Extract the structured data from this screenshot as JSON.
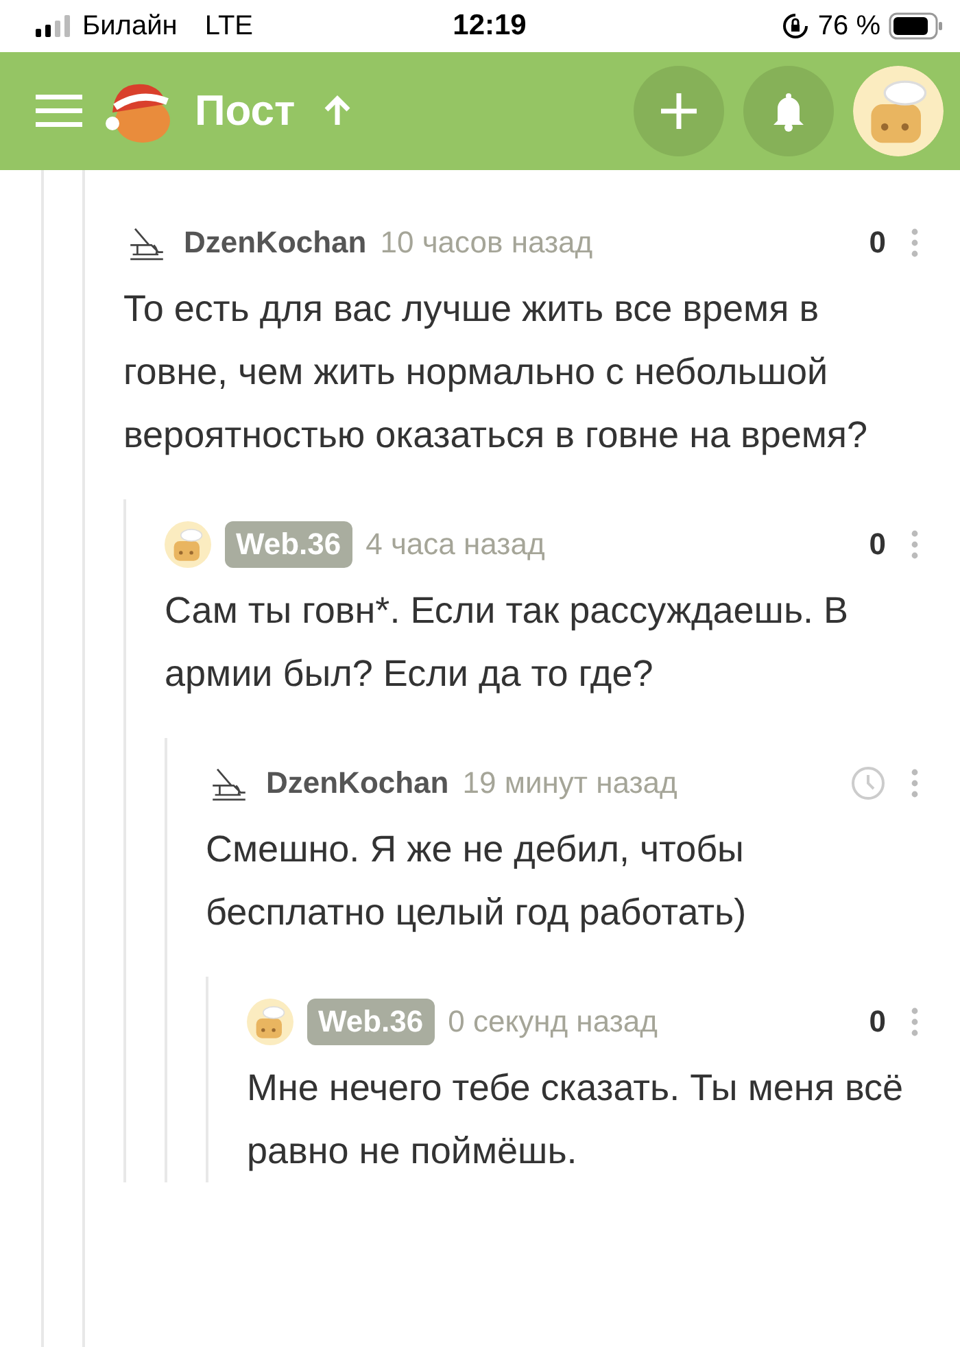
{
  "status_bar": {
    "carrier": "Билайн",
    "network": "LTE",
    "time": "12:19",
    "battery": "76 %"
  },
  "header": {
    "title": "Пост"
  },
  "comments": [
    {
      "author": "DzenKochan",
      "own": false,
      "time": "10 часов назад",
      "pending": false,
      "score": "0",
      "text": "То есть для вас лучше жить все время в говне, чем жить нормально с небольшой вероятностью оказаться в говне на время?",
      "children": [
        {
          "author": "Web.36",
          "own": true,
          "time": "4 часа назад",
          "pending": false,
          "score": "0",
          "text": "Сам ты говн*. Если так рассуждаешь. В армии был? Если да то где?",
          "children": [
            {
              "author": "DzenKochan",
              "own": false,
              "time": "19 минут назад",
              "pending": true,
              "text": "Смешно. Я же не дебил, чтобы бесплатно целый год работать)",
              "children": [
                {
                  "author": "Web.36",
                  "own": true,
                  "time": "0 секунд назад",
                  "pending": false,
                  "score": "0",
                  "text": "Мне нечего тебе сказать. Ты меня всё равно не поймёшь."
                }
              ]
            }
          ]
        }
      ]
    }
  ]
}
